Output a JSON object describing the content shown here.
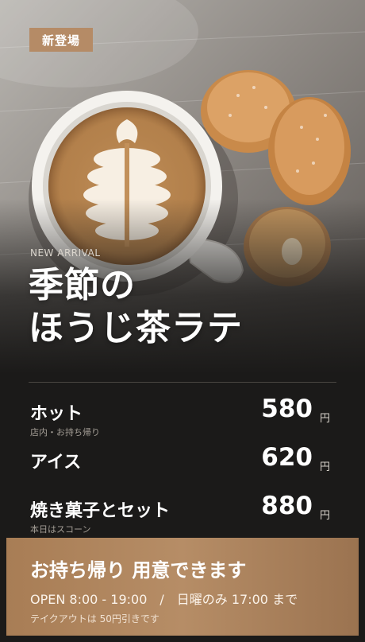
{
  "badge": "新登場",
  "kicker": "NEW ARRIVAL",
  "title": {
    "line1": "季節の",
    "line2": "ほうじ茶ラテ"
  },
  "menu": [
    {
      "name": "ホット",
      "note": "店内・お持ち帰り",
      "price": "580",
      "unit": "円"
    },
    {
      "name": "アイス",
      "note": "",
      "price": "620",
      "unit": "円"
    },
    {
      "name": "焼き菓子とセット",
      "note": "本日はスコーン",
      "price": "880",
      "unit": "円"
    }
  ],
  "footer": {
    "headline": "お持ち帰り 用意できます",
    "hours": "OPEN 8:00 - 19:00　/　日曜のみ 17:00 まで",
    "note": "テイクアウトは 50円引きです"
  },
  "colors": {
    "badge": "#b58b66",
    "footer": "#b08660",
    "background": "#1b1a19"
  },
  "imagery": {
    "photo": "latte-art-cup-with-madeleines"
  }
}
